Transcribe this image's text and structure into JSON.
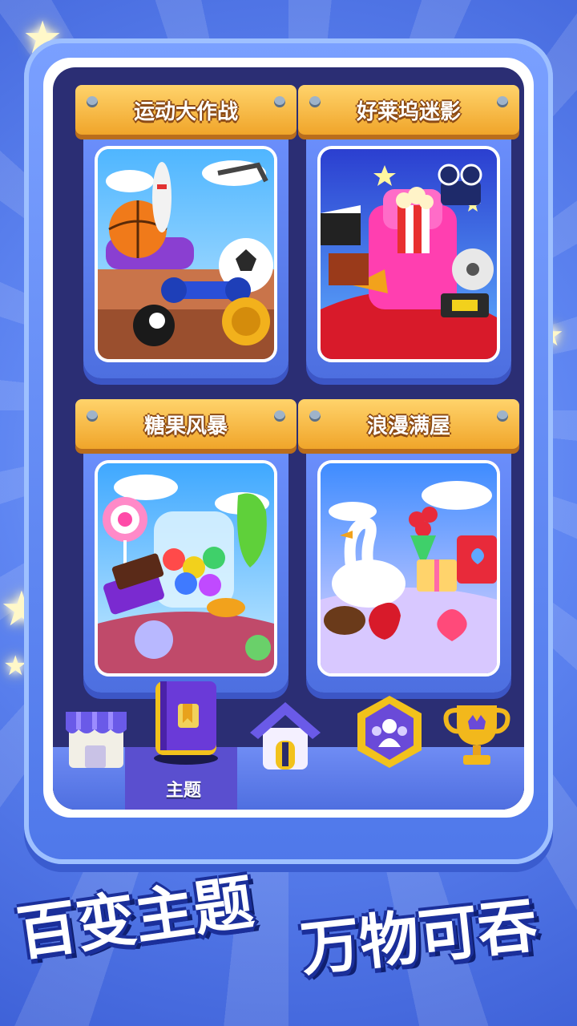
{
  "themes": [
    {
      "title": "运动大作战",
      "art": "sports-theme-art"
    },
    {
      "title": "好莱坞迷影",
      "art": "hollywood-theme-art"
    },
    {
      "title": "糖果风暴",
      "art": "candy-theme-art"
    },
    {
      "title": "浪漫满屋",
      "art": "romance-theme-art"
    }
  ],
  "nav": {
    "items": [
      {
        "icon": "shop-icon"
      },
      {
        "icon": "theme-book-icon",
        "label": "主题",
        "selected": true
      },
      {
        "icon": "home-icon"
      },
      {
        "icon": "team-icon"
      },
      {
        "icon": "trophy-icon"
      }
    ]
  },
  "slogan": {
    "left": "百变主题",
    "right": "万物可吞"
  },
  "colors": {
    "background": "#5f86f2",
    "panel": "#2b2e74",
    "banner": "#f0a52a",
    "accent": "#ffd36b"
  }
}
